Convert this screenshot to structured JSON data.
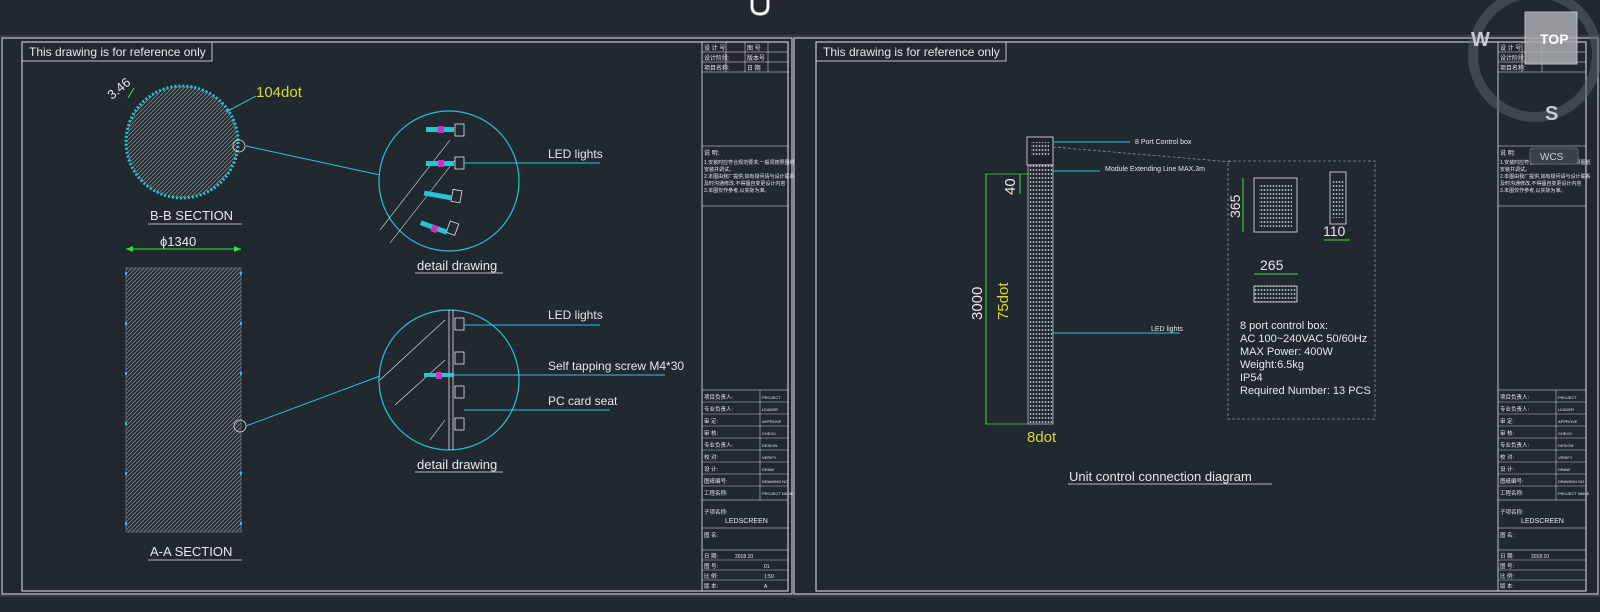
{
  "colors": {
    "background": "#212830",
    "frame": "#e8e8e8",
    "cyan": "#27c4d4",
    "yellow": "#d8d834",
    "magenta": "#d030c8",
    "dim_green": "#3ae03a"
  },
  "icons": {
    "cursor": "crosshair-cursor-icon",
    "viewcube": "viewcube-icon"
  },
  "left_sheet": {
    "reference_note": "This drawing is for reference only",
    "dot_label": "104dot",
    "pitch_label": "3.46",
    "section_bb": "B-B  SECTION",
    "section_aa": "A-A  SECTION",
    "diameter": "ϕ1340",
    "detail1": {
      "led_label": "LED lights",
      "caption": "detail drawing"
    },
    "detail2": {
      "led_label": "LED lights",
      "screw_label": "Self tapping screw M4*30",
      "pc_label": "PC card seat",
      "caption": "detail drawing"
    },
    "titleblock": {
      "header_rows": [
        [
          "设 计 号:",
          "图 号"
        ],
        [
          "设计阶段:",
          "版本号"
        ],
        [
          "项目名称:",
          "日 期"
        ]
      ],
      "notes_title": "说 明:",
      "notes": [
        "1.安装时应符合规范要求,一般须按照图纸",
        "  安装并调试。",
        "2.本图由我厂提供,如有疑问请与设计联系",
        "  及时沟通修改,不得擅自变更设计内容",
        "3.本图仅作参考,以实际为准。"
      ],
      "sign_rows": [
        [
          "项目负责人:",
          "PROJECT"
        ],
        [
          "专业负责人:",
          "LEADER"
        ],
        [
          "审 定:",
          "APPROVE"
        ],
        [
          "审 核:",
          "CHECK"
        ],
        [
          "专业负责人:",
          "DESIGN"
        ],
        [
          "校 对:",
          "VERIFY"
        ],
        [
          "设 计:",
          "DRAW"
        ],
        [
          "图纸编号:",
          "DRAWING NO"
        ],
        [
          "工程名称:",
          "PROJECT NAME"
        ]
      ],
      "drawing_title_label": "子项名称:",
      "drawing_title": "LEDSCREEN",
      "drawing_name_label": "图 名:",
      "bottom_rows": [
        [
          "日 期:",
          "2018.10"
        ],
        [
          "图 号:",
          "01"
        ],
        [
          "比 例:",
          "1:50"
        ],
        [
          "版 本:",
          "A"
        ]
      ]
    }
  },
  "right_sheet": {
    "reference_note": "This drawing is for reference only",
    "control_box_label": "8 Port Control box",
    "module_line_label": "Module Extending Line MAX.3m",
    "led_label": "LED lights",
    "dim_40": "40",
    "dim_3000": "3000",
    "dots_vertical": "75dot",
    "dots_bottom": "8dot",
    "dim_365": "365",
    "dim_110": "110",
    "dim_265": "265",
    "spec_lines": [
      "8 port control box:",
      "AC  100~240VAC  50/60Hz",
      "MAX Power:  400W",
      "Weight:6.5kg",
      "IP54",
      "Required Number:  13 PCS"
    ],
    "caption": "Unit control connection diagram"
  },
  "viewcube": {
    "west": "W",
    "south": "S",
    "top": "TOP",
    "wcs": "WCS"
  }
}
